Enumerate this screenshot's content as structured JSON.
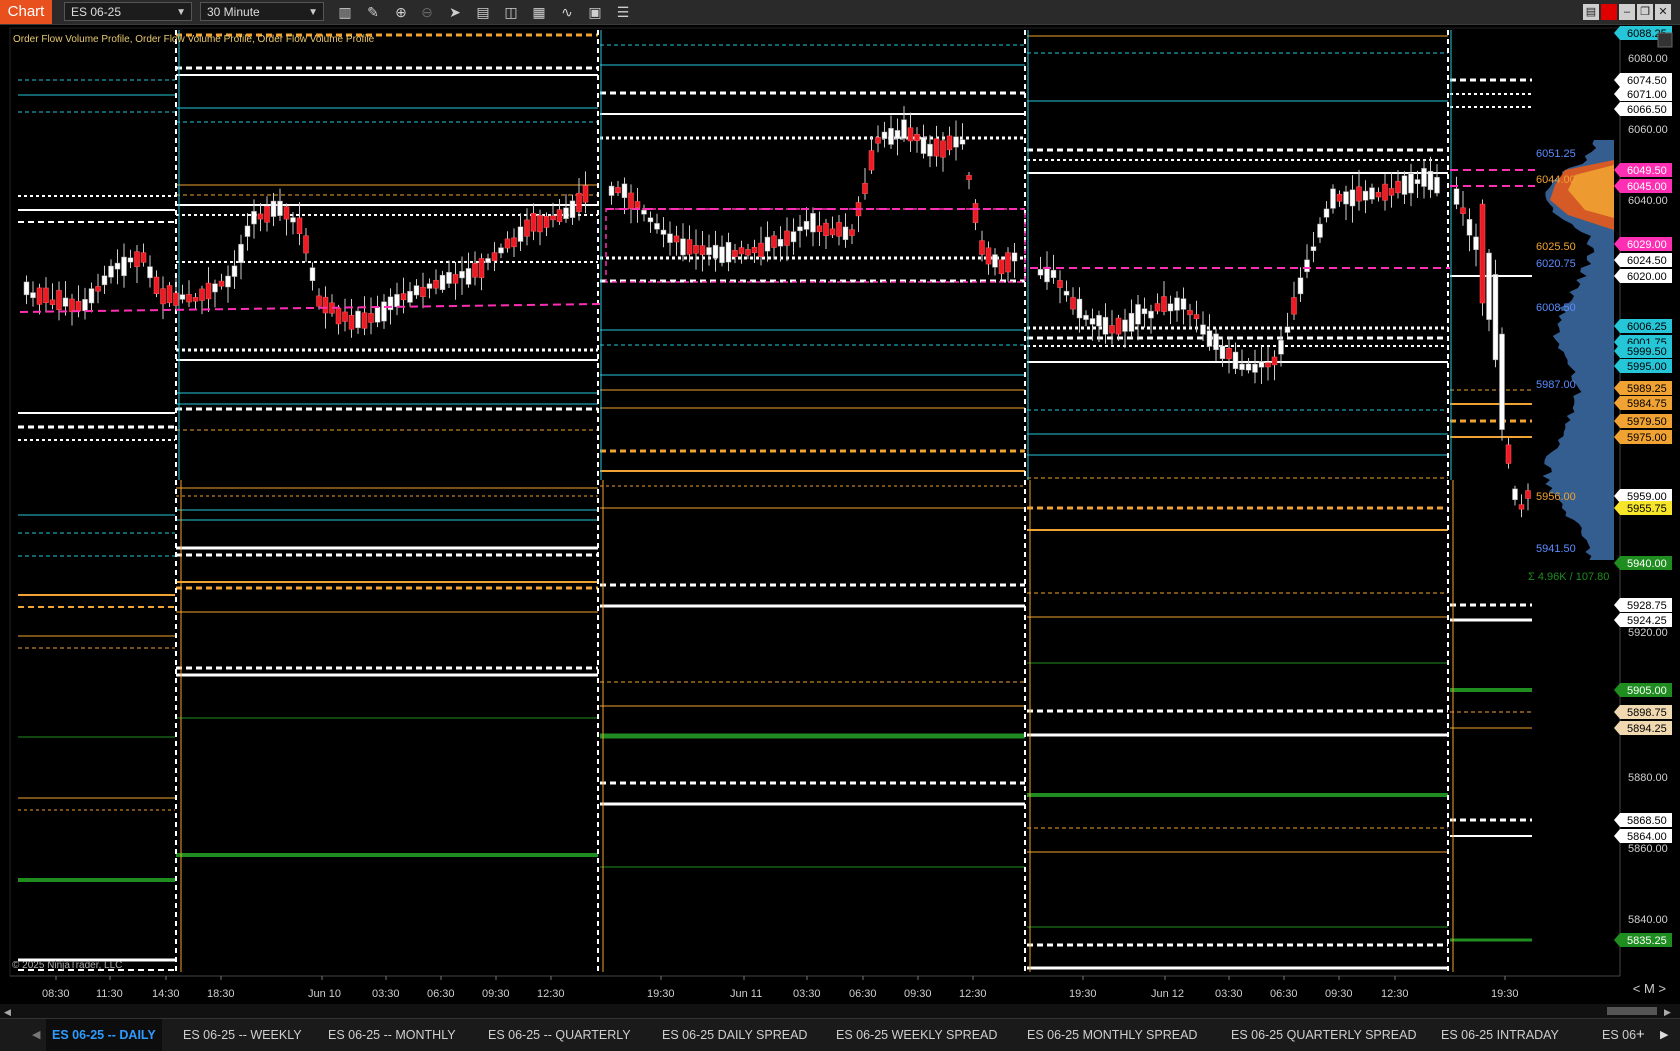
{
  "toolbar": {
    "chart_tab": "Chart",
    "instrument": "ES 06-25",
    "interval": "30 Minute"
  },
  "indicator_label": "Order Flow Volume Profile, Order Flow Volume Profile, Order Flow Volume Profile",
  "copyright": "© 2025 NinjaTrader, LLC",
  "zoom_controls": "< M >",
  "colors": {
    "background": "#000000",
    "up_candle": "#ffffff",
    "down_candle": "#ee1b24",
    "poc": "#ff2fb4",
    "value_area": "#25c6d8",
    "level_orange": "#f0a232",
    "level_green": "#1f8d1f",
    "level_white": "#ffffff"
  },
  "price_axis": {
    "labels": [
      "6080.00",
      "6060.00",
      "6040.00",
      "5920.00",
      "5880.00",
      "5860.00",
      "5840.00"
    ],
    "markers": [
      {
        "text": "6088.25",
        "bg": "#25c6d8",
        "fg": "#000"
      },
      {
        "text": "6074.50",
        "bg": "#ffffff",
        "fg": "#000"
      },
      {
        "text": "6071.00",
        "bg": "#ffffff",
        "fg": "#000"
      },
      {
        "text": "6066.50",
        "bg": "#ffffff",
        "fg": "#000"
      },
      {
        "text": "6049.50",
        "bg": "#ff2fb4",
        "fg": "#fff"
      },
      {
        "text": "6045.00",
        "bg": "#ff2fb4",
        "fg": "#fff"
      },
      {
        "text": "6029.00",
        "bg": "#ff2fb4",
        "fg": "#fff"
      },
      {
        "text": "6024.50",
        "bg": "#ffffff",
        "fg": "#000"
      },
      {
        "text": "6020.00",
        "bg": "#ffffff",
        "fg": "#000"
      },
      {
        "text": "6006.25",
        "bg": "#25c6d8",
        "fg": "#000"
      },
      {
        "text": "6001.75",
        "bg": "#25c6d8",
        "fg": "#000"
      },
      {
        "text": "5999.50",
        "bg": "#25c6d8",
        "fg": "#000"
      },
      {
        "text": "5995.00",
        "bg": "#25c6d8",
        "fg": "#000"
      },
      {
        "text": "5989.25",
        "bg": "#f0a232",
        "fg": "#000"
      },
      {
        "text": "5984.75",
        "bg": "#f0a232",
        "fg": "#000"
      },
      {
        "text": "5979.50",
        "bg": "#f0a232",
        "fg": "#000"
      },
      {
        "text": "5975.00",
        "bg": "#f0a232",
        "fg": "#000"
      },
      {
        "text": "5959.00",
        "bg": "#ffffff",
        "fg": "#000"
      },
      {
        "text": "5955.75",
        "bg": "#f6e52a",
        "fg": "#000"
      },
      {
        "text": "5940.00",
        "bg": "#1f8d1f",
        "fg": "#fff"
      },
      {
        "text": "5928.75",
        "bg": "#ffffff",
        "fg": "#000"
      },
      {
        "text": "5924.25",
        "bg": "#ffffff",
        "fg": "#000"
      },
      {
        "text": "5905.00",
        "bg": "#1f8d1f",
        "fg": "#fff"
      },
      {
        "text": "5898.75",
        "bg": "#f0d8b0",
        "fg": "#000"
      },
      {
        "text": "5894.25",
        "bg": "#f0d8b0",
        "fg": "#000"
      },
      {
        "text": "5868.50",
        "bg": "#ffffff",
        "fg": "#000"
      },
      {
        "text": "5864.00",
        "bg": "#ffffff",
        "fg": "#000"
      },
      {
        "text": "5835.25",
        "bg": "#1f8d1f",
        "fg": "#fff"
      }
    ]
  },
  "profile_labels": [
    {
      "text": "6051.25",
      "color": "#5a8cff"
    },
    {
      "text": "6044.00",
      "color": "#f0a232"
    },
    {
      "text": "6025.50",
      "color": "#f0a232"
    },
    {
      "text": "6020.75",
      "color": "#5a8cff"
    },
    {
      "text": "6008.50",
      "color": "#5a8cff"
    },
    {
      "text": "5987.00",
      "color": "#5a8cff"
    },
    {
      "text": "5956.00",
      "color": "#f0a232"
    },
    {
      "text": "5941.50",
      "color": "#5a8cff"
    },
    {
      "text": "Σ 4.96K / 107.80",
      "color": "#1f8d1f"
    }
  ],
  "time_axis": [
    "08:30",
    "11:30",
    "14:30",
    "18:30",
    "Jun 10",
    "03:30",
    "06:30",
    "09:30",
    "12:30",
    "19:30",
    "Jun 11",
    "03:30",
    "06:30",
    "09:30",
    "12:30",
    "19:30",
    "Jun 12",
    "03:30",
    "06:30",
    "09:30",
    "12:30",
    "19:30"
  ],
  "bottom_tabs": [
    {
      "label": "ES 06-25 -- DAILY",
      "active": true
    },
    {
      "label": "ES 06-25 -- WEEKLY",
      "active": false
    },
    {
      "label": "ES 06-25 -- MONTHLY",
      "active": false
    },
    {
      "label": "ES 06-25 -- QUARTERLY",
      "active": false
    },
    {
      "label": "ES 06-25 DAILY SPREAD",
      "active": false
    },
    {
      "label": "ES 06-25 WEEKLY SPREAD",
      "active": false
    },
    {
      "label": "ES 06-25 MONTHLY SPREAD",
      "active": false
    },
    {
      "label": "ES 06-25 QUARTERLY SPREAD",
      "active": false
    },
    {
      "label": "ES 06-25 INTRADAY",
      "active": false
    },
    {
      "label": "ES 06",
      "active": false
    }
  ]
}
